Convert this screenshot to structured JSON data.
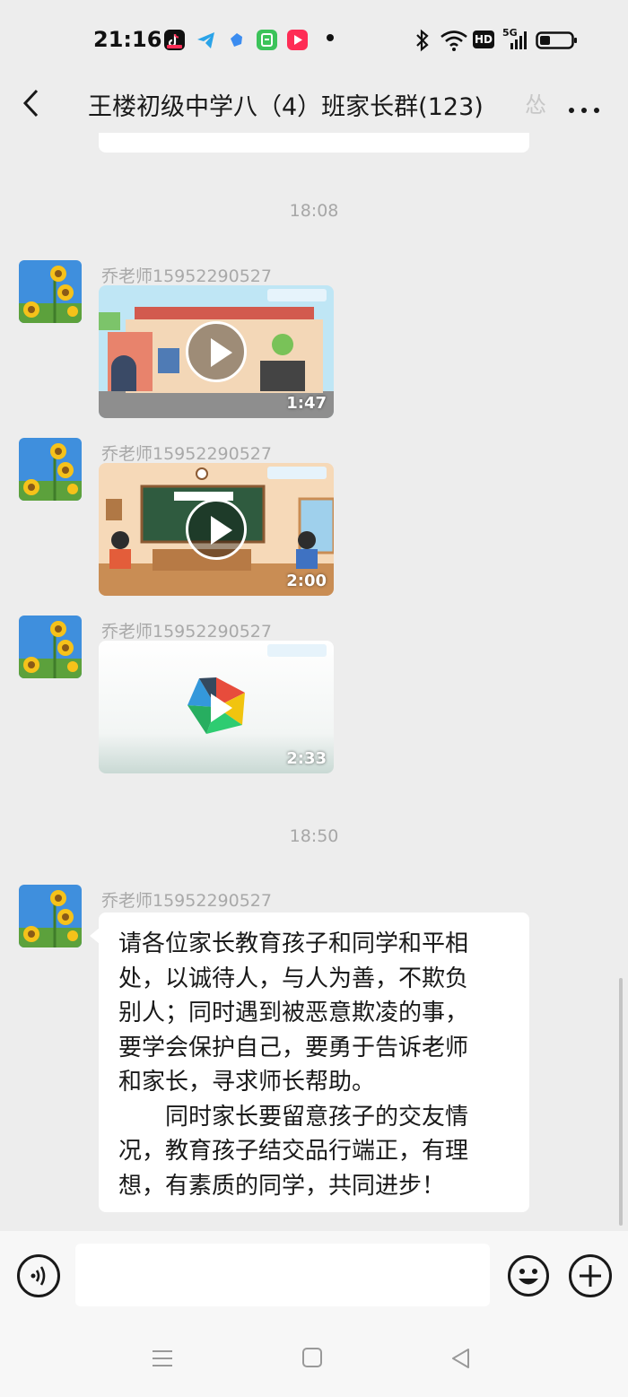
{
  "status_bar": {
    "time": "21:16",
    "hd_label": "HD",
    "network_label": "5G",
    "app_icons": [
      "douyin-icon",
      "telegram-icon",
      "blue-app-icon",
      "green-app-icon",
      "red-play-app-icon"
    ]
  },
  "header": {
    "title": "王楼初级中学八（4）班家长群(123)",
    "title_overflow_char": "怂"
  },
  "chat": {
    "messages": [
      {
        "type": "timestamp",
        "text": "18:08"
      },
      {
        "type": "video",
        "sender": "乔老师15952290527",
        "duration": "1:47",
        "scene": "school-gate"
      },
      {
        "type": "video",
        "sender": "乔老师15952290527",
        "duration": "2:00",
        "scene": "classroom"
      },
      {
        "type": "video",
        "sender": "乔老师15952290527",
        "duration": "2:33",
        "scene": "logo"
      },
      {
        "type": "timestamp",
        "text": "18:50"
      },
      {
        "type": "text",
        "sender": "乔老师15952290527",
        "lines": [
          "请各位家长教育孩子和同学和平相",
          "处，以诚待人，与人为善，不欺负",
          "别人；同时遇到被恶意欺凌的事，",
          "要学会保护自己，要勇于告诉老师",
          "和家长，寻求师长帮助。",
          "　　同时家长要留意孩子的交友情",
          "况，教育孩子结交品行端正，有理",
          "想，有素质的同学，共同进步！"
        ]
      }
    ]
  },
  "colors": {
    "background": "#ededed",
    "bubble": "#ffffff",
    "timestamp": "#a7a7a7",
    "sender": "#a9a9a9"
  },
  "input_bar": {
    "message_value": ""
  }
}
